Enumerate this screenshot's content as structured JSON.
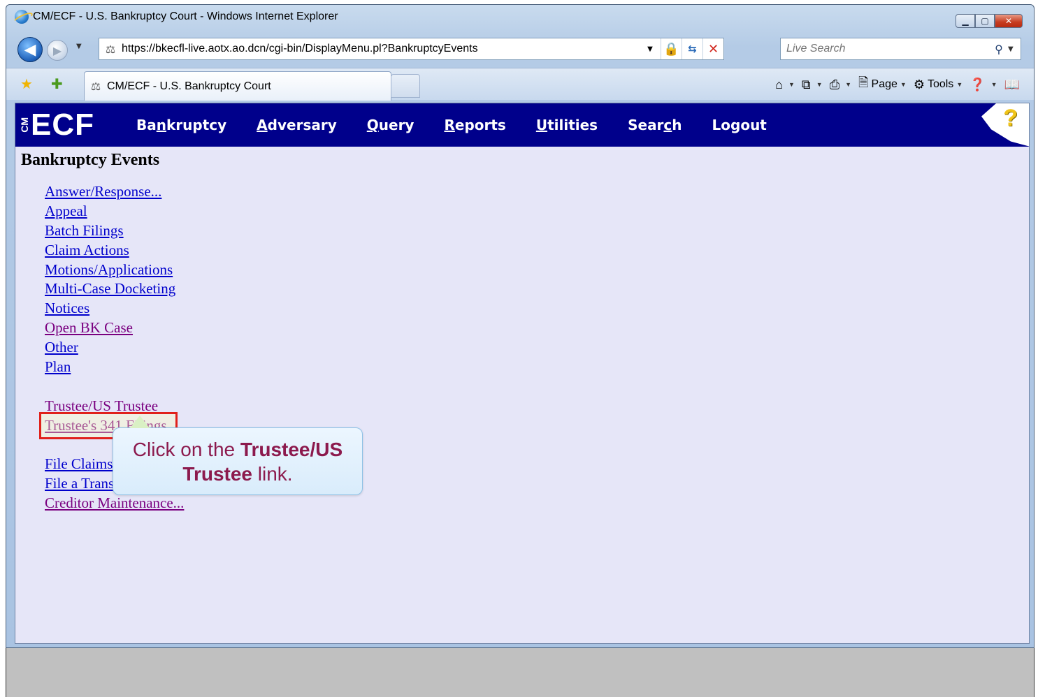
{
  "window": {
    "title": "CM/ECF - U.S. Bankruptcy Court - Windows Internet Explorer",
    "minimize": "▁",
    "restore": "▢",
    "close": "✕"
  },
  "nav": {
    "back": "◀",
    "forward": "▶",
    "url": "https://bkecfl-live.aotx.ao.dcn/cgi-bin/DisplayMenu.pl?BankruptcyEvents",
    "search_placeholder": "Live Search"
  },
  "tab": {
    "label": "CM/ECF - U.S. Bankruptcy Court"
  },
  "commands": {
    "page": "Page",
    "tools": "Tools"
  },
  "ecf": {
    "logo_cm": "CM",
    "logo_ecf": "ECF",
    "menu": [
      {
        "pre": "Ba",
        "u": "n",
        "post": "kruptcy"
      },
      {
        "pre": "",
        "u": "A",
        "post": "dversary"
      },
      {
        "pre": "",
        "u": "Q",
        "post": "uery"
      },
      {
        "pre": "",
        "u": "R",
        "post": "eports"
      },
      {
        "pre": "",
        "u": "U",
        "post": "tilities"
      },
      {
        "pre": "Sear",
        "u": "c",
        "post": "h"
      },
      {
        "pre": "Logout",
        "u": "",
        "post": ""
      }
    ],
    "help": "?"
  },
  "page": {
    "heading": "Bankruptcy Events",
    "links": [
      "Answer/Response...",
      "Appeal",
      "Batch Filings",
      "Claim Actions",
      "Motions/Applications",
      "Multi-Case Docketing",
      "Notices",
      "Open BK Case",
      "Other",
      "Plan",
      "Trustee/US Trustee",
      "Trustee's 341 Filings",
      "File Claims",
      "File a Transfer of Claim",
      "Creditor Maintenance..."
    ]
  },
  "callout": {
    "pre": "Click on the ",
    "bold": "Trustee/US Trustee",
    "post": " link."
  }
}
